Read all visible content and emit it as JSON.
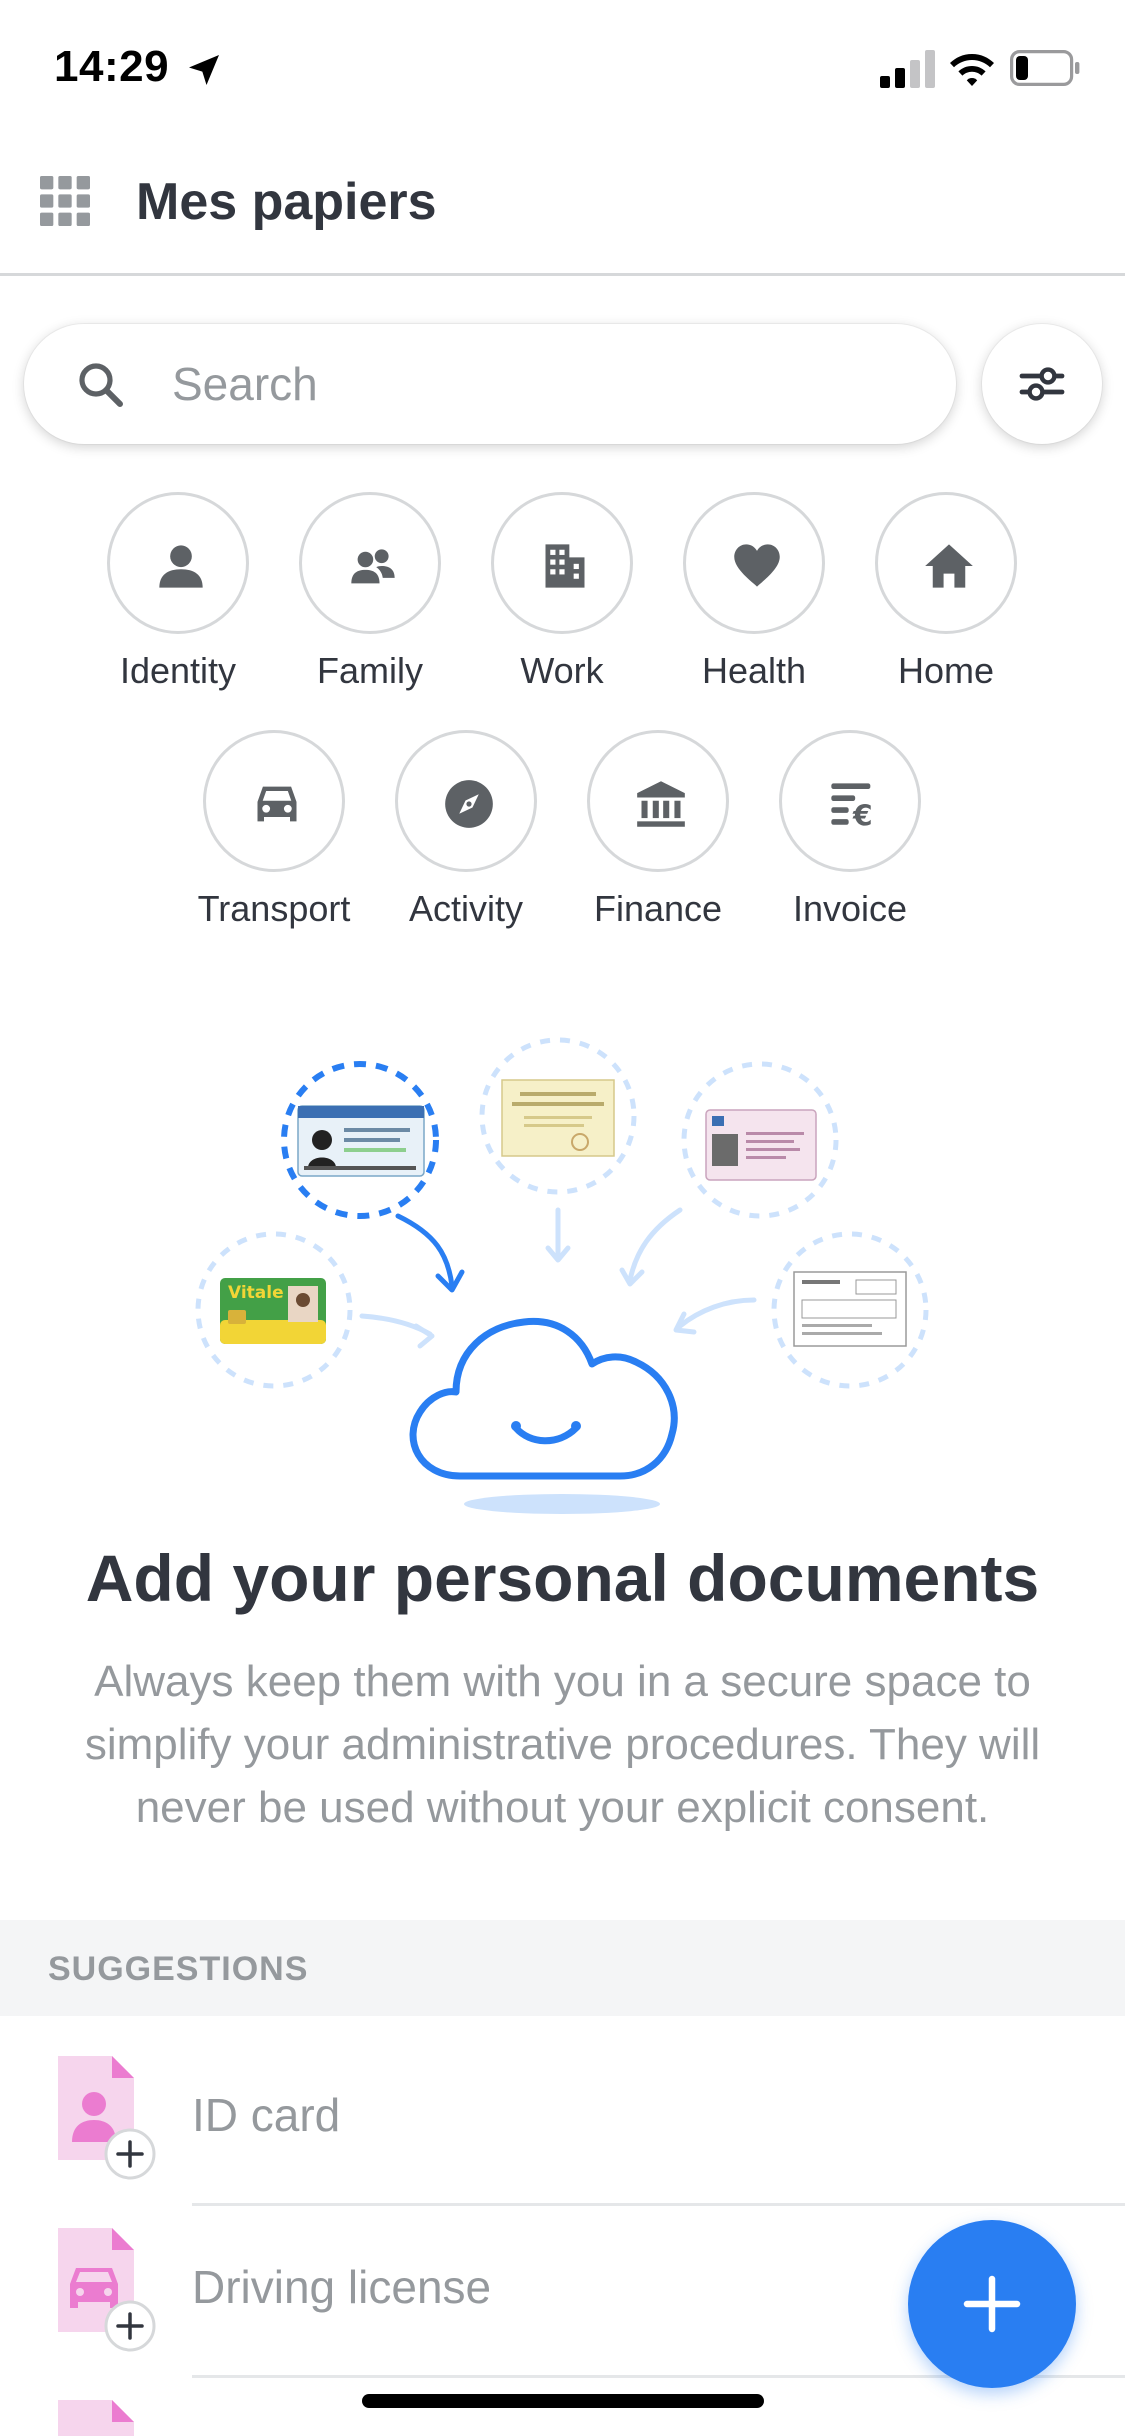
{
  "status_bar": {
    "time": "14:29"
  },
  "header": {
    "title": "Mes papiers"
  },
  "search": {
    "placeholder": "Search"
  },
  "categories": [
    {
      "label": "Identity",
      "icon": "person-icon"
    },
    {
      "label": "Family",
      "icon": "family-icon"
    },
    {
      "label": "Work",
      "icon": "building-icon"
    },
    {
      "label": "Health",
      "icon": "heart-icon"
    },
    {
      "label": "Home",
      "icon": "house-icon"
    },
    {
      "label": "Transport",
      "icon": "car-icon"
    },
    {
      "label": "Activity",
      "icon": "compass-icon"
    },
    {
      "label": "Finance",
      "icon": "bank-icon"
    },
    {
      "label": "Invoice",
      "icon": "invoice-icon"
    }
  ],
  "empty_state": {
    "title": "Add your personal documents",
    "text": "Always keep them with you in a secure space to simplify your administrative procedures. They will never be used without your explicit consent."
  },
  "suggestions": {
    "header": "SUGGESTIONS",
    "items": [
      {
        "label": "ID card",
        "icon": "id-card-icon"
      },
      {
        "label": "Driving license",
        "icon": "driving-license-icon"
      }
    ]
  },
  "colors": {
    "primary": "#297ef2",
    "text": "#32363f",
    "muted": "#95999d",
    "border": "#d6d8da",
    "icon": "#5d6165",
    "doc_pink": "#f6d5ed",
    "doc_pink_dark": "#eb7cd0"
  }
}
